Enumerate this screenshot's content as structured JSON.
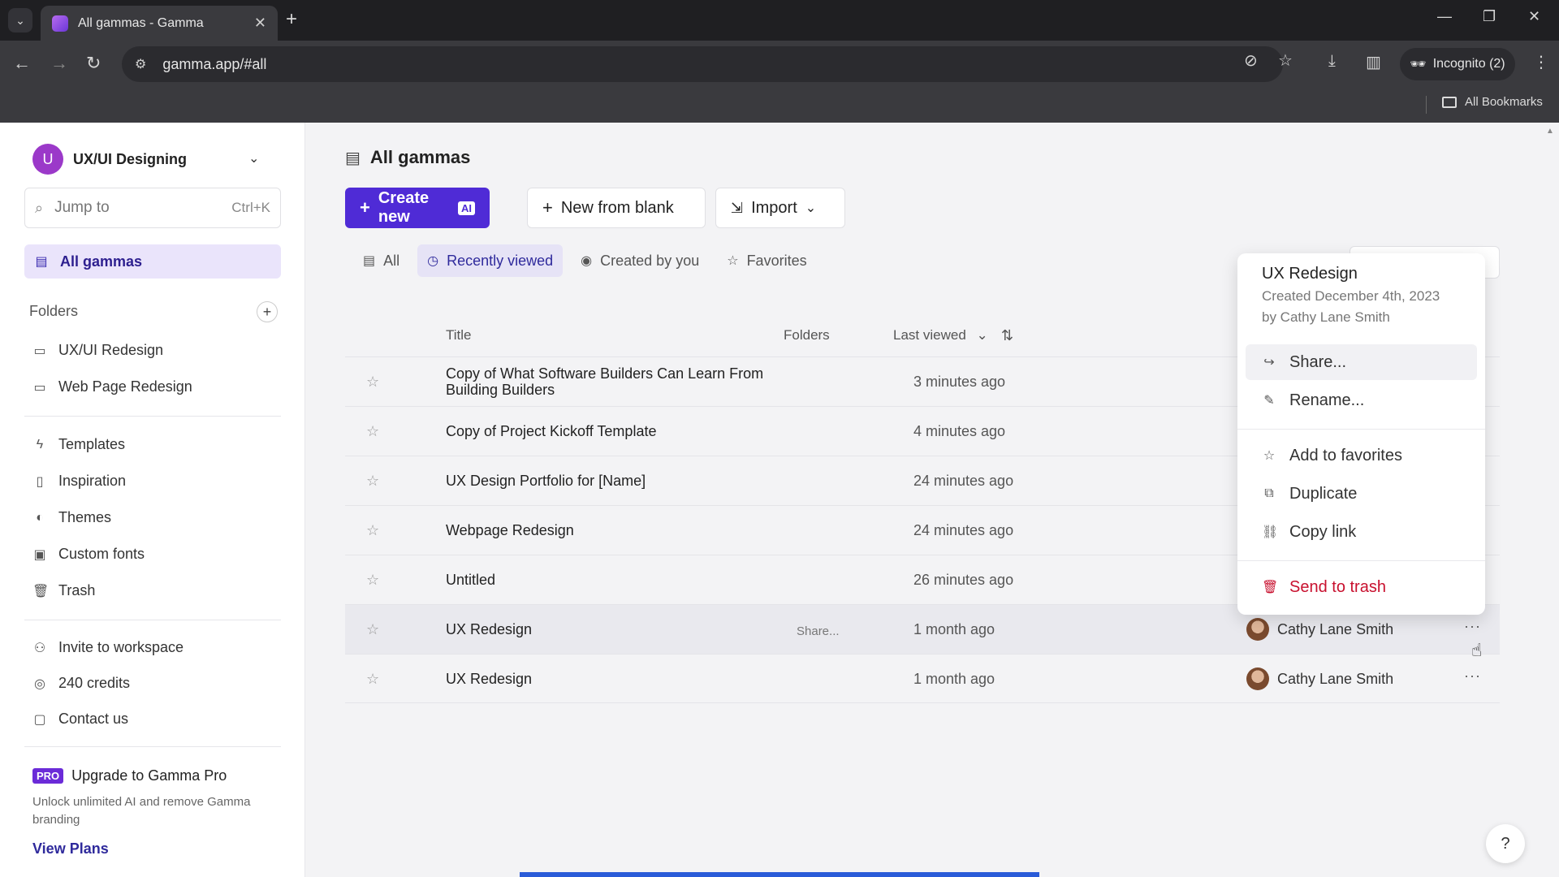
{
  "browser": {
    "tab_title": "All gammas - Gamma",
    "url": "gamma.app/#all",
    "incognito_label": "Incognito (2)",
    "bookmarks_label": "All Bookmarks"
  },
  "sidebar": {
    "workspace_initial": "U",
    "workspace_name": "UX/UI Designing",
    "search_placeholder": "Jump to",
    "search_shortcut": "Ctrl+K",
    "active_item": "All gammas",
    "folders_title": "Folders",
    "folders": [
      "UX/UI Redesign",
      "Web Page Redesign"
    ],
    "links": [
      "Templates",
      "Inspiration",
      "Themes",
      "Custom fonts",
      "Trash"
    ],
    "bottom_links": [
      "Invite to workspace",
      "240 credits",
      "Contact us"
    ],
    "pro_badge": "PRO",
    "pro_title": "Upgrade to Gamma Pro",
    "pro_desc": "Unlock unlimited AI and remove Gamma branding",
    "view_plans": "View Plans"
  },
  "main": {
    "title": "All gammas",
    "create_new": "Create new",
    "ai_tag": "AI",
    "new_from_blank": "New from blank",
    "import": "Import",
    "filters": [
      "All",
      "Recently viewed",
      "Created by you",
      "Favorites"
    ],
    "columns": {
      "title": "Title",
      "folders": "Folders",
      "last_viewed": "Last viewed"
    },
    "rows": [
      {
        "title": "Copy of What Software Builders Can Learn From Building Builders",
        "folder": "",
        "viewed": "3 minutes ago",
        "owner": ""
      },
      {
        "title": "Copy of Project Kickoff Template",
        "folder": "",
        "viewed": "4 minutes ago",
        "owner": ""
      },
      {
        "title": "UX Design Portfolio for [Name]",
        "folder": "",
        "viewed": "24 minutes ago",
        "owner": ""
      },
      {
        "title": "Webpage Redesign",
        "folder": "",
        "viewed": "24 minutes ago",
        "owner": ""
      },
      {
        "title": "Untitled",
        "folder": "",
        "viewed": "26 minutes ago",
        "owner": ""
      },
      {
        "title": "UX Redesign",
        "folder": "Share...",
        "viewed": "1 month ago",
        "owner": "Cathy Lane Smith"
      },
      {
        "title": "UX Redesign",
        "folder": "",
        "viewed": "1 month ago",
        "owner": "Cathy Lane Smith"
      }
    ]
  },
  "menu": {
    "title": "UX Redesign",
    "created": "Created December 4th, 2023",
    "by": "by Cathy Lane Smith",
    "share": "Share...",
    "rename": "Rename...",
    "add_fav": "Add to favorites",
    "duplicate": "Duplicate",
    "copy_link": "Copy link",
    "trash": "Send to trash"
  },
  "help": "?",
  "colors": {
    "accent": "#4f2bd6",
    "active_bg": "#eae4fb",
    "danger": "#c8102e"
  }
}
